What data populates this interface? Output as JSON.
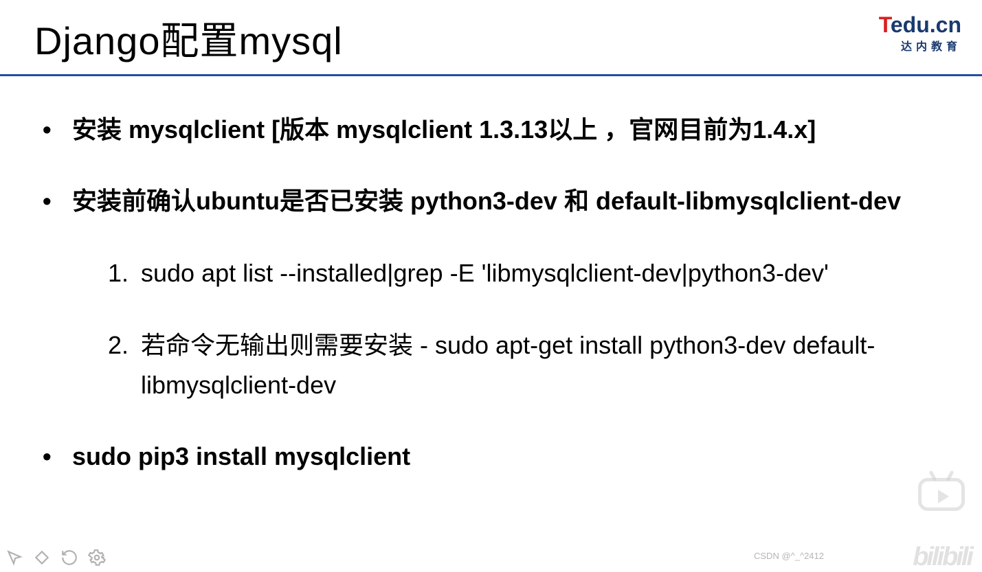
{
  "header": {
    "title": "Django配置mysql",
    "logo_t": "T",
    "logo_rest": "edu.cn",
    "logo_sub": "达内教育"
  },
  "content": {
    "bullets": [
      {
        "text": "安装 mysqlclient [版本 mysqlclient 1.3.13以上 ，官网目前为1.4.x]"
      },
      {
        "text": "安装前确认ubuntu是否已安装 python3-dev 和  default-libmysqlclient-dev",
        "numbered": [
          {
            "num": "1.",
            "text": "sudo apt list --installed|grep -E 'libmysqlclient-dev|python3-dev'"
          },
          {
            "num": "2.",
            "text": "若命令无输出则需要安装 -  sudo apt-get install python3-dev default-libmysqlclient-dev"
          }
        ]
      },
      {
        "text": "sudo pip3 install mysqlclient"
      }
    ]
  },
  "watermark": "CSDN @^_^2412",
  "bili": "bilibili"
}
